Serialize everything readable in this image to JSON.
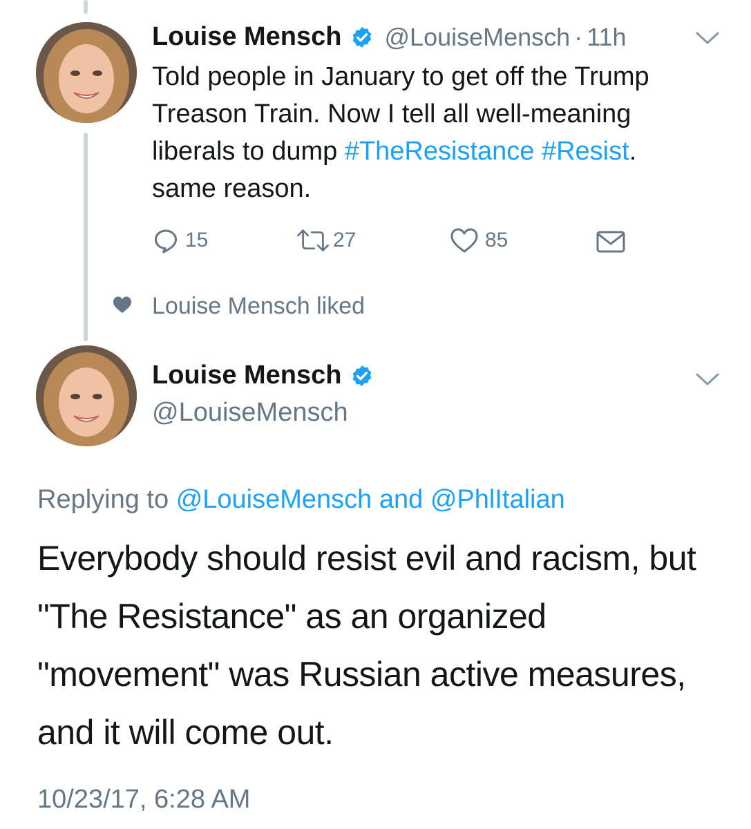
{
  "tweet1": {
    "author_name": "Louise Mensch",
    "handle": "@LouiseMensch",
    "separator": "·",
    "time": "11h",
    "text_before": "Told people in January to get off the Trump Treason Train. Now I tell all well-meaning liberals to dump ",
    "hashtag1": "#TheResistance",
    "space": " ",
    "hashtag2": "#Resist",
    "text_after": ". same reason.",
    "replies": "15",
    "retweets": "27",
    "likes": "85"
  },
  "social_context": {
    "text": "Louise Mensch liked"
  },
  "tweet2": {
    "author_name": "Louise Mensch",
    "handle": "@LouiseMensch",
    "replying_prefix": "Replying to",
    "mention1": "@LouiseMensch",
    "and_word": "and",
    "mention2": "@PhlItalian",
    "text": "Everybody should resist evil and racism, but \"The Resistance\" as an organized \"movement\" was Russian active measures, and it will come out.",
    "timestamp": "10/23/17, 6:28 AM"
  },
  "colors": {
    "link": "#1da1f2",
    "secondary": "#657786",
    "thread_line": "#ccd6dd",
    "text": "#14171a"
  },
  "icons": {
    "reply": "speech-bubble",
    "retweet": "retweet-arrows",
    "like": "heart-outline",
    "dm": "envelope",
    "liked_indicator": "heart-filled",
    "verified": "verified-badge",
    "caret": "chevron-down"
  }
}
